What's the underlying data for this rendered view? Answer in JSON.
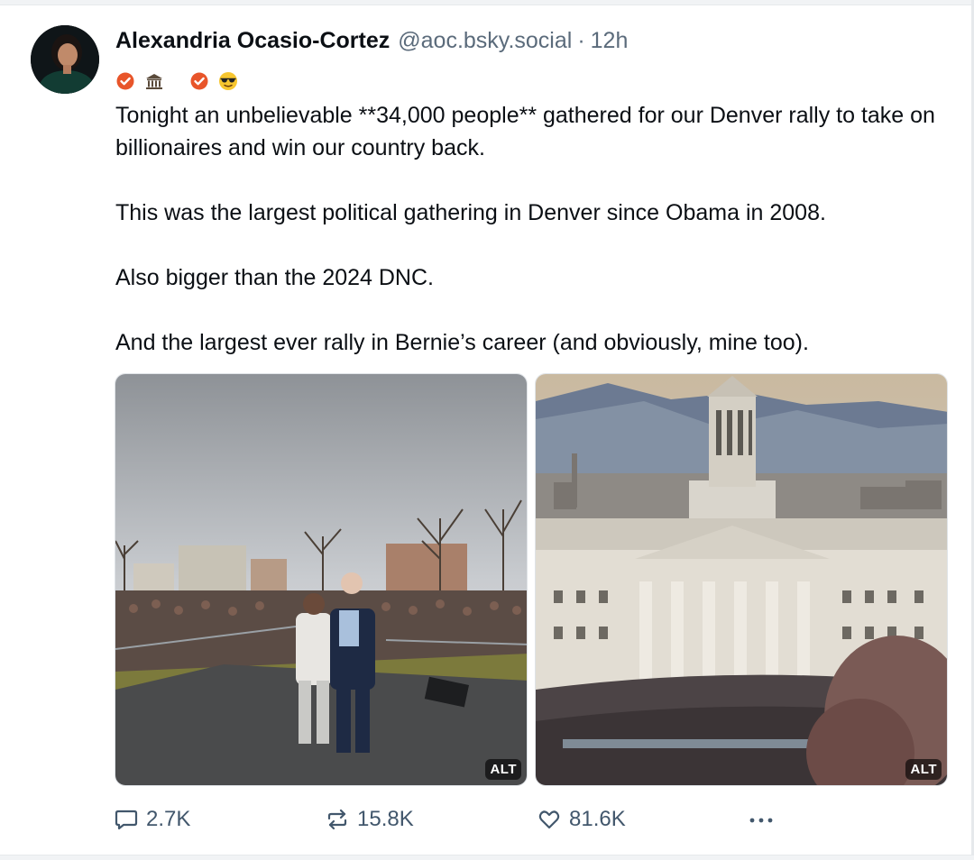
{
  "post": {
    "author": {
      "display_name": "Alexandria Ocasio-Cortez",
      "handle": "@aoc.bsky.social",
      "separator": "·",
      "time": "12h"
    },
    "badges": [
      {
        "icon": "orange-check-badge-icon"
      },
      {
        "icon": "capitol-building-icon"
      },
      {
        "icon": "orange-check-badge-icon"
      },
      {
        "icon": "sunglasses-emoji-icon"
      }
    ],
    "text": {
      "p1": "Tonight an unbelievable **34,000 people** gathered for our Denver rally to take on billionaires and win our country back.",
      "p2": "This was the largest political gathering in Denver since Obama in 2008.",
      "p3": "Also bigger than the 2024 DNC.",
      "p4": "And the largest ever rally in Bernie’s career (and obviously, mine too)."
    },
    "media": [
      {
        "alt_badge": "ALT"
      },
      {
        "alt_badge": "ALT"
      }
    ],
    "actions": {
      "reply_count": "2.7K",
      "repost_count": "15.8K",
      "like_count": "81.6K"
    },
    "colors": {
      "text": "#0b0f14",
      "muted": "#5b6b7b",
      "action": "#42576c",
      "badge_orange": "#e8552a"
    }
  }
}
